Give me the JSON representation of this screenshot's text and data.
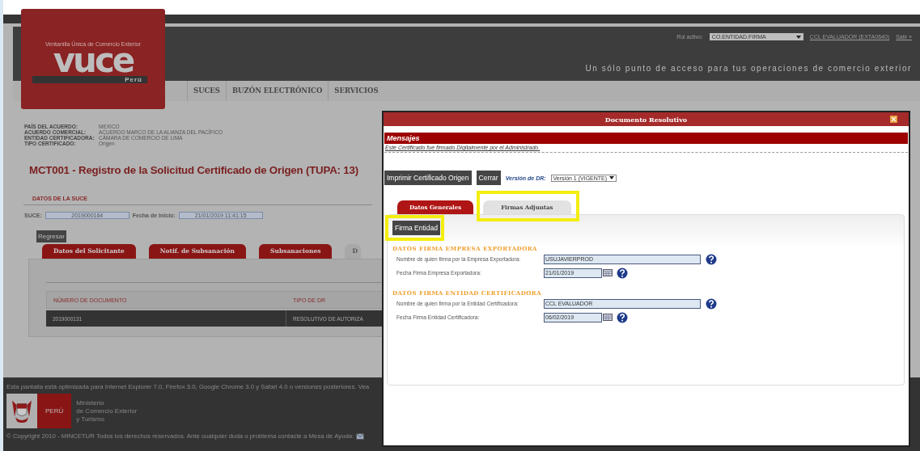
{
  "header": {
    "system_name": "Ventanilla Única de Comercio Exterior",
    "logo": "vuce",
    "country": "Perú",
    "role_label": "Rol activo:",
    "role_value": "CO.ENTIDAD.FIRMA",
    "user": "CCL EVALUADOR (EXTA0640)",
    "logout": "Salir »",
    "tagline": "Un sólo punto de acceso para tus operaciones de comercio exterior"
  },
  "nav": [
    {
      "label": "SUCES"
    },
    {
      "label": "BUZÓN ELECTRÓNICO"
    },
    {
      "label": "SERVICIOS"
    }
  ],
  "info": [
    {
      "label": "PAÍS DEL ACUERDO:",
      "value": "MEXICO"
    },
    {
      "label": "ACUERDO COMERCIAL:",
      "value": "ACUERDO MARCO DE LA ALIANZA DEL PACÍFICO"
    },
    {
      "label": "ENTIDAD CERTIFICADORA:",
      "value": "CÁMARA DE COMERCIO DE LIMA"
    },
    {
      "label": "TIPO CERTIFICADO:",
      "value": "Origen"
    }
  ],
  "page_title": "MCT001 - Registro de la Solicitud Certificado de Origen (TUPA: 13)",
  "suce": {
    "title": "DATOS DE LA SUCE",
    "suce_label": "SUCE:",
    "suce_value": "2019000164",
    "date_label": "Fecha de Inicio:",
    "date_value": "21/01/2019 11:41:15"
  },
  "back_button": "Regresar",
  "tabs": [
    {
      "label": "Datos del Solicitante",
      "selected": false
    },
    {
      "label": "Notif. de Subsanación",
      "selected": false
    },
    {
      "label": "Subsanaciones",
      "selected": false
    },
    {
      "label": "D",
      "selected": true
    }
  ],
  "table": {
    "columns": [
      "NÚMERO DE DOCUMENTO",
      "TIPO DE DR"
    ],
    "rows": [
      [
        "2019000131",
        "RESOLUTIVO DE AUTORIZA"
      ]
    ]
  },
  "footer": {
    "browser_note": "Esta pantalla está optimizada para Internet Explorer 7.0, Firefox 3.0, Google Chrome 3.0 y Safari 4.0 o versiones posteriores. Vea",
    "country": "PERÚ",
    "ministry": [
      "Ministerio",
      "de Comercio Exterior",
      "y Turismo"
    ],
    "copyright": "© Copyright 2010 - MINCETUR Todos los derechos reservados. Ante cualquier duda o problema contacte a Mesa de Ayuda:"
  },
  "dialog": {
    "title": "Documento Resolutivo",
    "messages_title": "Mensajes",
    "message": "Este Certificado fue firmado Digitalmente por el Administrado.",
    "buttons": [
      "Imprimir Certificado Origen",
      "Cerrar"
    ],
    "version_label": "Versión de DR:",
    "version_value": "Versión 1 (VIGENTE)",
    "tabs": [
      {
        "label": "Datos Generales",
        "selected": false,
        "highlighted": false
      },
      {
        "label": "Firmas Adjuntas",
        "selected": true,
        "highlighted": true
      }
    ],
    "action_button": {
      "label": "Firma Entidad",
      "highlighted": true
    },
    "sections": [
      {
        "title": "DATOS FIRMA EMPRESA EXPORTADORA",
        "fields": [
          {
            "kind": "text",
            "label": "Nombre de quien firma por la Empresa Exportadora:",
            "value": "USUJAVIERPROD"
          },
          {
            "kind": "date",
            "label": "Fecha Firma Empresa Exportadora:",
            "value": "21/01/2019"
          }
        ]
      },
      {
        "title": "DATOS FIRMA ENTIDAD CERTIFICADORA",
        "fields": [
          {
            "kind": "text",
            "label": "Nombre de quien firma por la Entidad Certificadora:",
            "value": "CCL EVALUADOR"
          },
          {
            "kind": "date",
            "label": "Fecha Firma Entidad Certificadora:",
            "value": "06/02/2019"
          }
        ]
      }
    ]
  }
}
